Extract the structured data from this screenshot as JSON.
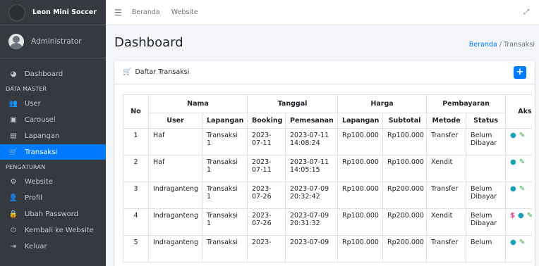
{
  "sidebar": {
    "brand": "Leon Mini Soccer",
    "user": "Administrator",
    "items": [
      {
        "type": "item",
        "icon": "dashboard-icon",
        "glyph": "◕",
        "label": "Dashboard",
        "active": false
      },
      {
        "type": "header",
        "label": "DATA MASTER"
      },
      {
        "type": "item",
        "icon": "users-icon",
        "glyph": "👥",
        "label": "User",
        "active": false
      },
      {
        "type": "item",
        "icon": "image-icon",
        "glyph": "▣",
        "label": "Carousel",
        "active": false
      },
      {
        "type": "item",
        "icon": "field-icon",
        "glyph": "▤",
        "label": "Lapangan",
        "active": false
      },
      {
        "type": "item",
        "icon": "cart-icon",
        "glyph": "🛒",
        "label": "Transaksi",
        "active": true
      },
      {
        "type": "header",
        "label": "PENGATURAN"
      },
      {
        "type": "item",
        "icon": "cogs-icon",
        "glyph": "⚙",
        "label": "Website",
        "active": false
      },
      {
        "type": "item",
        "icon": "profile-icon",
        "glyph": "👤",
        "label": "Profil",
        "active": false
      },
      {
        "type": "item",
        "icon": "lock-icon",
        "glyph": "🔒",
        "label": "Ubah Password",
        "active": false
      },
      {
        "type": "item",
        "icon": "power-icon",
        "glyph": "⏻",
        "label": "Kembali ke Website",
        "active": false
      },
      {
        "type": "item",
        "icon": "logout-icon",
        "glyph": "⇥",
        "label": "Keluar",
        "active": false
      }
    ]
  },
  "topbar": {
    "menu_icon": "hamburger-icon",
    "links": [
      "Beranda",
      "Website"
    ],
    "expand_icon": "expand-icon"
  },
  "header": {
    "title": "Dashboard",
    "breadcrumb": [
      "Beranda",
      "Transaksi"
    ],
    "breadcrumb_sep": "/"
  },
  "card": {
    "title": "Daftar Transaksi",
    "title_icon": "cart-icon",
    "add_label": "+"
  },
  "table": {
    "group_headers": [
      "No",
      "Nama",
      "Tanggal",
      "Harga",
      "Pembayaran",
      "Aksi"
    ],
    "sub_headers": [
      "User",
      "Lapangan",
      "Booking",
      "Pemesanan",
      "Lapangan",
      "Subtotal",
      "Metode",
      "Status"
    ],
    "rows": [
      {
        "no": "1",
        "user": "Haf",
        "lapangan": "Transaksi 1",
        "booking": "2023-07-11",
        "pemesanan": "2023-07-11 14:08:24",
        "harga": "Rp100.000",
        "subtotal": "Rp100.000",
        "metode": "Transfer",
        "status": "Belum Dibayar",
        "pay": false
      },
      {
        "no": "2",
        "user": "Haf",
        "lapangan": "Transaksi 1",
        "booking": "2023-07-11",
        "pemesanan": "2023-07-11 14:05:15",
        "harga": "Rp100.000",
        "subtotal": "Rp100.000",
        "metode": "Xendit",
        "status": "",
        "pay": false
      },
      {
        "no": "3",
        "user": "Indraganteng",
        "lapangan": "Transaksi 1",
        "booking": "2023-07-26",
        "pemesanan": "2023-07-09 20:32:42",
        "harga": "Rp100.000",
        "subtotal": "Rp200.000",
        "metode": "Transfer",
        "status": "Belum Dibayar",
        "pay": false
      },
      {
        "no": "4",
        "user": "Indraganteng",
        "lapangan": "Transaksi 1",
        "booking": "2023-07-26",
        "pemesanan": "2023-07-09 20:31:32",
        "harga": "Rp100.000",
        "subtotal": "Rp200.000",
        "metode": "Xendit",
        "status": "Belum Dibayar",
        "pay": true
      },
      {
        "no": "5",
        "user": "Indraganteng",
        "lapangan": "Transaksi",
        "booking": "2023-",
        "pemesanan": "2023-07-09",
        "harga": "Rp100.000",
        "subtotal": "Rp200.000",
        "metode": "Transfer",
        "status": "Belum",
        "pay": false
      }
    ]
  },
  "colors": {
    "sidebar_bg": "#343a40",
    "accent": "#007bff",
    "info": "#17a2b8",
    "edit": "#28a745",
    "pay": "#e83e8c"
  }
}
